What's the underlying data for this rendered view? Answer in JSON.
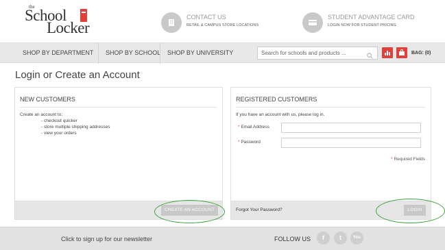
{
  "logo": {
    "the": "the",
    "line1": "School",
    "line2": "Locker"
  },
  "header": {
    "contact": {
      "title": "CONTACT US",
      "subtitle": "RETAIL & CAMPUS STORE LOCATIONS",
      "icon": "building-icon"
    },
    "student_card": {
      "title": "STUDENT ADVANTAGE CARD",
      "subtitle": "LOGIN NOW FOR STUDENT PRICING",
      "icon": "card-icon"
    }
  },
  "nav": {
    "items": [
      "SHOP BY DEPARTMENT",
      "SHOP BY SCHOOL",
      "SHOP BY UNIVERSITY"
    ],
    "search_placeholder": "Search for schools and products ...",
    "bag_label": "BAG: (0)"
  },
  "page": {
    "title": "Login or Create an Account"
  },
  "new_customers": {
    "heading": "NEW CUSTOMERS",
    "intro": "Create an account to:",
    "bullets": [
      "- checkout quicker",
      "- store multiple shipping addresses",
      "- view your orders"
    ],
    "button": "CREATE AN ACCOUNT"
  },
  "registered": {
    "heading": "REGISTERED CUSTOMERS",
    "intro": "If you have an account with us, please log in.",
    "email_label": "Email Address",
    "password_label": "Password",
    "required_star": "*",
    "required_note": "Required Fields",
    "forgot": "Forgot Your Password?",
    "button": "LOGIN"
  },
  "footer": {
    "newsletter": "Click to sign up for our newsletter",
    "follow": "FOLLOW US",
    "social": [
      {
        "icon": "facebook-icon",
        "glyph": "f"
      },
      {
        "icon": "twitter-icon",
        "glyph": "t"
      },
      {
        "icon": "youtube-icon",
        "glyph": "You"
      }
    ]
  },
  "colors": {
    "accent": "#e2403a",
    "highlight_ring": "#3aa13a",
    "button_grey": "#c8c8c8"
  }
}
